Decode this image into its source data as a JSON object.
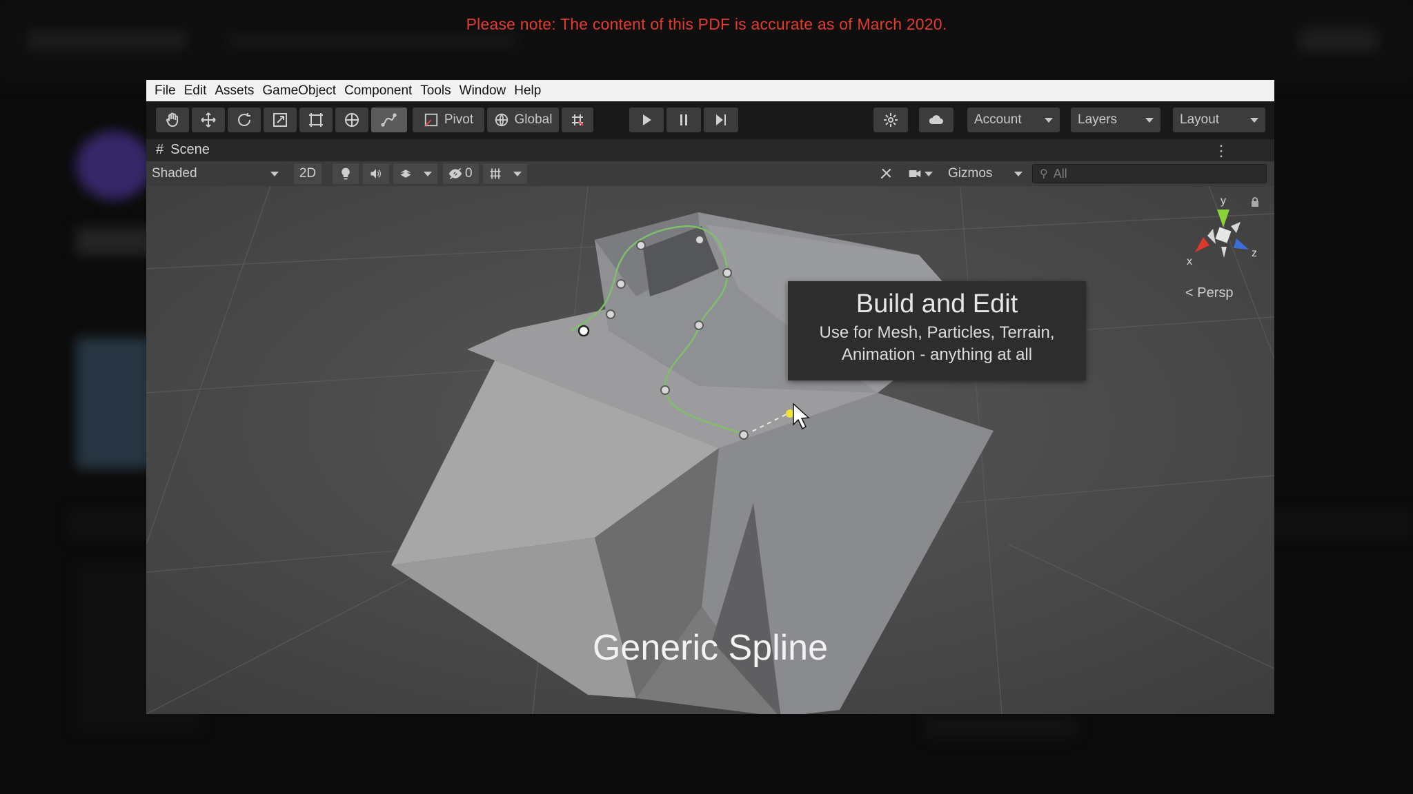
{
  "notice": "Please note: The content of this PDF is accurate as of March 2020.",
  "menu": [
    "File",
    "Edit",
    "Assets",
    "GameObject",
    "Component",
    "Tools",
    "Window",
    "Help"
  ],
  "toolbar": {
    "tools": [
      "hand-icon",
      "move-icon",
      "rotate-icon",
      "scale-icon",
      "rect-icon",
      "transform-icon",
      "custom-editor-icon"
    ],
    "pivot_label": "Pivot",
    "global_label": "Global",
    "account_label": "Account",
    "layers_label": "Layers",
    "layout_label": "Layout"
  },
  "scene": {
    "tab_label": "Scene",
    "shading_mode": "Shaded",
    "mode_2d": "2D",
    "hidden_count": "0",
    "gizmos_label": "Gizmos",
    "search_placeholder": "All",
    "projection_label": "Persp",
    "axes": {
      "y": "y",
      "x": "x",
      "z": "z"
    }
  },
  "tooltip": {
    "title": "Build and Edit",
    "line1": "Use for Mesh, Particles, Terrain,",
    "line2": "Animation - anything at all"
  },
  "caption": "Generic Spline",
  "colors": {
    "notice": "#e53b2d",
    "spline": "#7fbf6a",
    "axis_y": "#8bd13a",
    "axis_x": "#d93a2b",
    "axis_z": "#3a6fd9"
  }
}
